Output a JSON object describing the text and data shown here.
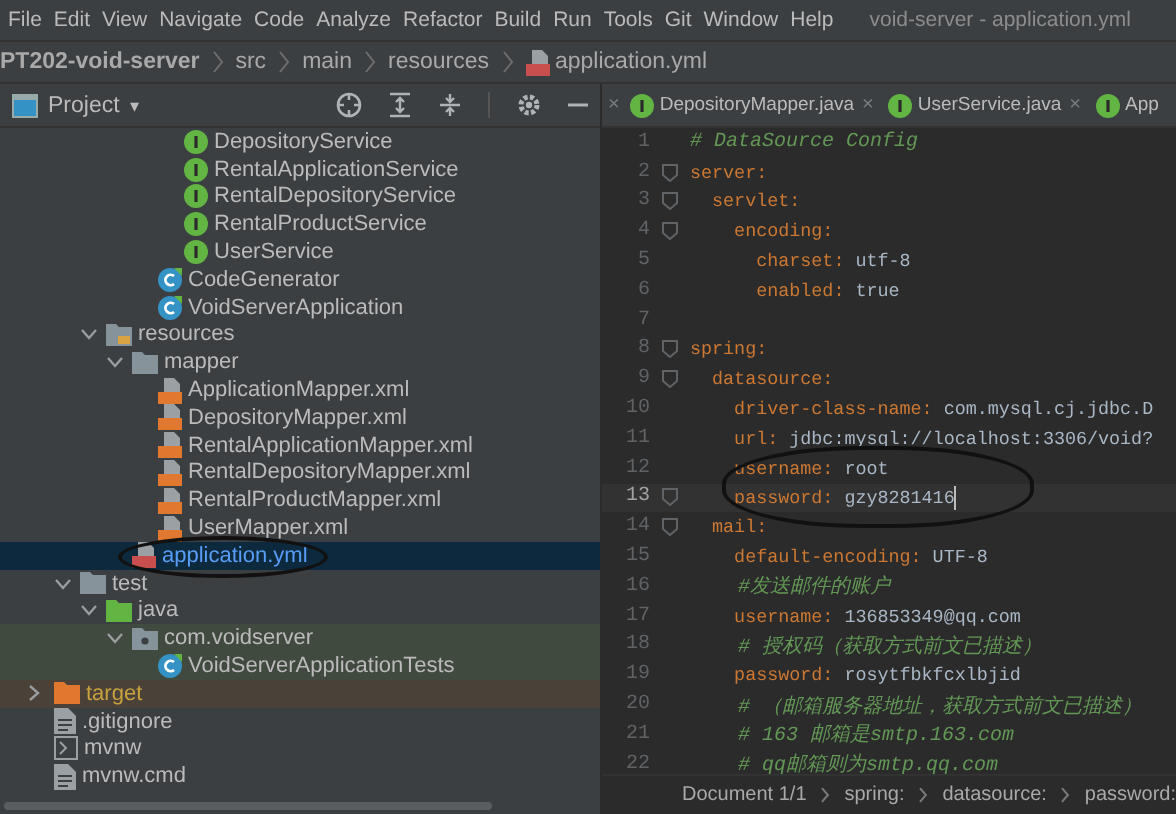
{
  "menu": [
    "File",
    "Edit",
    "View",
    "Navigate",
    "Code",
    "Analyze",
    "Refactor",
    "Build",
    "Run",
    "Tools",
    "Git",
    "Window",
    "Help"
  ],
  "window": {
    "title": "void-server - application.yml"
  },
  "breadcrumbs": [
    {
      "label": "PT202-void-server",
      "kind": "project"
    },
    {
      "label": "src",
      "kind": "folder"
    },
    {
      "label": "main",
      "kind": "folder"
    },
    {
      "label": "resources",
      "kind": "folder"
    },
    {
      "label": "application.yml",
      "kind": "file"
    }
  ],
  "project_panel": {
    "title": "Project",
    "caret": "▾",
    "tree": [
      {
        "children": [
          {
            "children": [
              {
                "children": [
                  {
                    "children": [
                      {
                        "children": [
                          {
                            "label": "DepositoryService",
                            "kind": "interface",
                            "selected": false
                          },
                          {
                            "label": "RentalApplicationService",
                            "kind": "interface",
                            "selected": false
                          },
                          {
                            "label": "RentalDepositoryService",
                            "kind": "interface",
                            "selected": false
                          },
                          {
                            "label": "RentalProductService",
                            "kind": "interface",
                            "selected": false
                          },
                          {
                            "label": "UserService",
                            "kind": "interface",
                            "selected": false
                          }
                        ]
                      },
                      {
                        "label": "CodeGenerator",
                        "kind": "class",
                        "selected": false
                      },
                      {
                        "label": "VoidServerApplication",
                        "kind": "class",
                        "selected": false
                      }
                    ]
                  }
                ]
              },
              {
                "label": "resources",
                "kind": "resources-folder",
                "expanded": true,
                "selected": false,
                "children": [
                  {
                    "label": "mapper",
                    "kind": "folder",
                    "expanded": true,
                    "selected": false,
                    "children": [
                      {
                        "label": "ApplicationMapper.xml",
                        "kind": "xml",
                        "selected": false
                      },
                      {
                        "label": "DepositoryMapper.xml",
                        "kind": "xml",
                        "selected": false
                      },
                      {
                        "label": "RentalApplicationMapper.xml",
                        "kind": "xml",
                        "selected": false
                      },
                      {
                        "label": "RentalDepositoryMapper.xml",
                        "kind": "xml",
                        "selected": false
                      },
                      {
                        "label": "RentalProductMapper.xml",
                        "kind": "xml",
                        "selected": false
                      },
                      {
                        "label": "UserMapper.xml",
                        "kind": "xml",
                        "selected": false
                      }
                    ]
                  },
                  {
                    "label": "application.yml",
                    "kind": "yml",
                    "selected": true,
                    "circled": true
                  }
                ]
              }
            ]
          },
          {
            "label": "test",
            "kind": "folder",
            "expanded": true,
            "selected": false,
            "children": [
              {
                "label": "java",
                "kind": "test-source-folder",
                "expanded": true,
                "selected": false,
                "children": [
                  {
                    "label": "com.voidserver",
                    "kind": "package",
                    "expanded": true,
                    "selected": false,
                    "children": [
                      {
                        "label": "VoidServerApplicationTests",
                        "kind": "class",
                        "selected": false
                      }
                    ]
                  }
                ]
              }
            ]
          }
        ]
      },
      {
        "label": "target",
        "kind": "excluded-folder",
        "expanded": false,
        "selected": false
      },
      {
        "label": ".gitignore",
        "kind": "file",
        "selected": false
      },
      {
        "label": "mvnw",
        "kind": "script",
        "selected": false
      },
      {
        "label": "mvnw.cmd",
        "kind": "file",
        "selected": false
      }
    ]
  },
  "editor": {
    "leading_close": "×",
    "tabs": [
      {
        "label": "DepositoryMapper.java",
        "close": "×",
        "selected": false
      },
      {
        "label": "UserService.java",
        "close": "×",
        "selected": false
      },
      {
        "label": "App",
        "selected": false
      }
    ],
    "lines": [
      {
        "number": "1",
        "tokens": [
          {
            "kind": "comment",
            "text": "# DataSource Config"
          }
        ]
      },
      {
        "number": "2",
        "fold": true,
        "tokens": [
          {
            "kind": "key",
            "text": "server"
          },
          {
            "kind": "colon",
            "text": ":"
          }
        ]
      },
      {
        "number": "3",
        "fold": true,
        "tokens": [
          {
            "kind": "key",
            "text": "  servlet"
          },
          {
            "kind": "colon",
            "text": ":"
          }
        ]
      },
      {
        "number": "4",
        "fold": true,
        "tokens": [
          {
            "kind": "key",
            "text": "    encoding"
          },
          {
            "kind": "colon",
            "text": ":"
          }
        ]
      },
      {
        "number": "5",
        "tokens": [
          {
            "kind": "key",
            "text": "      charset"
          },
          {
            "kind": "colon",
            "text": ":"
          },
          {
            "kind": "value",
            "text": " utf-8"
          }
        ]
      },
      {
        "number": "6",
        "tokens": [
          {
            "kind": "key",
            "text": "      enabled"
          },
          {
            "kind": "colon",
            "text": ":"
          },
          {
            "kind": "value",
            "text": " true"
          }
        ]
      },
      {
        "number": "7"
      },
      {
        "number": "8",
        "fold": true,
        "tokens": [
          {
            "kind": "key",
            "text": "spring"
          },
          {
            "kind": "colon",
            "text": ":"
          }
        ]
      },
      {
        "number": "9",
        "fold": true,
        "tokens": [
          {
            "kind": "key",
            "text": "  datasource"
          },
          {
            "kind": "colon",
            "text": ":"
          }
        ]
      },
      {
        "number": "10",
        "tokens": [
          {
            "kind": "key",
            "text": "    driver-class-name"
          },
          {
            "kind": "colon",
            "text": ":"
          },
          {
            "kind": "value",
            "text": " com.mysql.cj.jdbc.D"
          }
        ]
      },
      {
        "number": "11",
        "tokens": [
          {
            "kind": "key",
            "text": "    url"
          },
          {
            "kind": "colon",
            "text": ":"
          },
          {
            "kind": "value",
            "text": " jdbc:mysql://localhost:3306/void?"
          }
        ]
      },
      {
        "number": "12",
        "circled": true,
        "tokens": [
          {
            "kind": "key",
            "text": "    username"
          },
          {
            "kind": "colon",
            "text": ":"
          },
          {
            "kind": "value",
            "text": " root"
          }
        ]
      },
      {
        "number": "13",
        "circled": true,
        "current": true,
        "fold": true,
        "tokens": [
          {
            "kind": "key",
            "text": "    password"
          },
          {
            "kind": "colon",
            "text": ":"
          },
          {
            "kind": "value",
            "text": " gzy8281416"
          }
        ]
      },
      {
        "number": "14",
        "fold": true,
        "tokens": [
          {
            "kind": "key",
            "text": "  mail"
          },
          {
            "kind": "colon",
            "text": ":"
          }
        ]
      },
      {
        "number": "15",
        "tokens": [
          {
            "kind": "key",
            "text": "    default-encoding"
          },
          {
            "kind": "colon",
            "text": ":"
          },
          {
            "kind": "value",
            "text": " UTF-8"
          }
        ]
      },
      {
        "number": "16",
        "tokens": [
          {
            "kind": "comment",
            "text": "    #发送邮件的账户"
          }
        ]
      },
      {
        "number": "17",
        "tokens": [
          {
            "kind": "key",
            "text": "    username"
          },
          {
            "kind": "colon",
            "text": ":"
          },
          {
            "kind": "value",
            "text": " 136853349@qq.com"
          }
        ]
      },
      {
        "number": "18",
        "tokens": [
          {
            "kind": "comment",
            "text": "    # 授权码（获取方式前文已描述）"
          }
        ]
      },
      {
        "number": "19",
        "tokens": [
          {
            "kind": "key",
            "text": "    password"
          },
          {
            "kind": "colon",
            "text": ":"
          },
          {
            "kind": "value",
            "text": " rosytfbkfcxlbjid"
          }
        ]
      },
      {
        "number": "20",
        "tokens": [
          {
            "kind": "comment",
            "text": "    # （邮箱服务器地址，获取方式前文已描述）"
          }
        ]
      },
      {
        "number": "21",
        "tokens": [
          {
            "kind": "comment",
            "text": "    # 163 邮箱是smtp.163.com"
          }
        ]
      },
      {
        "number": "22",
        "tokens": [
          {
            "kind": "comment",
            "text": "    # qq邮箱则为smtp.qq.com"
          }
        ]
      }
    ],
    "path": [
      "Document 1/1",
      "spring:",
      "datasource:",
      "password:"
    ]
  }
}
